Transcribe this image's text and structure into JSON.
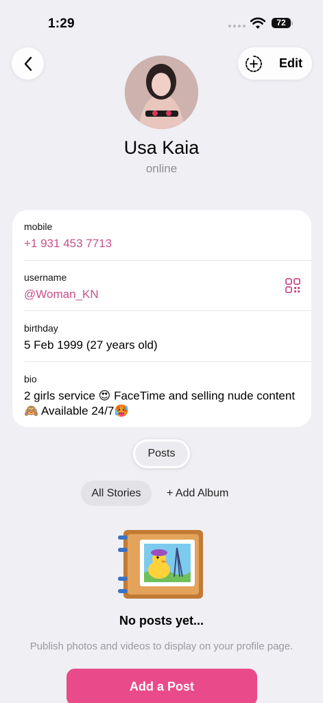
{
  "status_bar": {
    "time": "1:29",
    "battery": "72"
  },
  "header": {
    "edit_label": "Edit"
  },
  "profile": {
    "name": "Usa Kaia",
    "status": "online"
  },
  "info": {
    "mobile_label": "mobile",
    "mobile_value": "+1 931 453 7713",
    "username_label": "username",
    "username_value": "@Woman_KN",
    "birthday_label": "birthday",
    "birthday_value": "5 Feb 1999 (27 years old)",
    "bio_label": "bio",
    "bio_value": "2 girls service 😍 FaceTime and selling nude content 🙈 Available 24/7🥵"
  },
  "tabs": {
    "posts_label": "Posts"
  },
  "albums": {
    "all_stories_label": "All Stories",
    "add_album_label": "+ Add Album"
  },
  "empty_state": {
    "title": "No posts yet...",
    "subtitle": "Publish photos and videos to display on your profile page."
  },
  "actions": {
    "add_post_label": "Add a Post"
  },
  "colors": {
    "accent": "#c84f8a",
    "button": "#e94b8a",
    "background": "#efeff4"
  }
}
